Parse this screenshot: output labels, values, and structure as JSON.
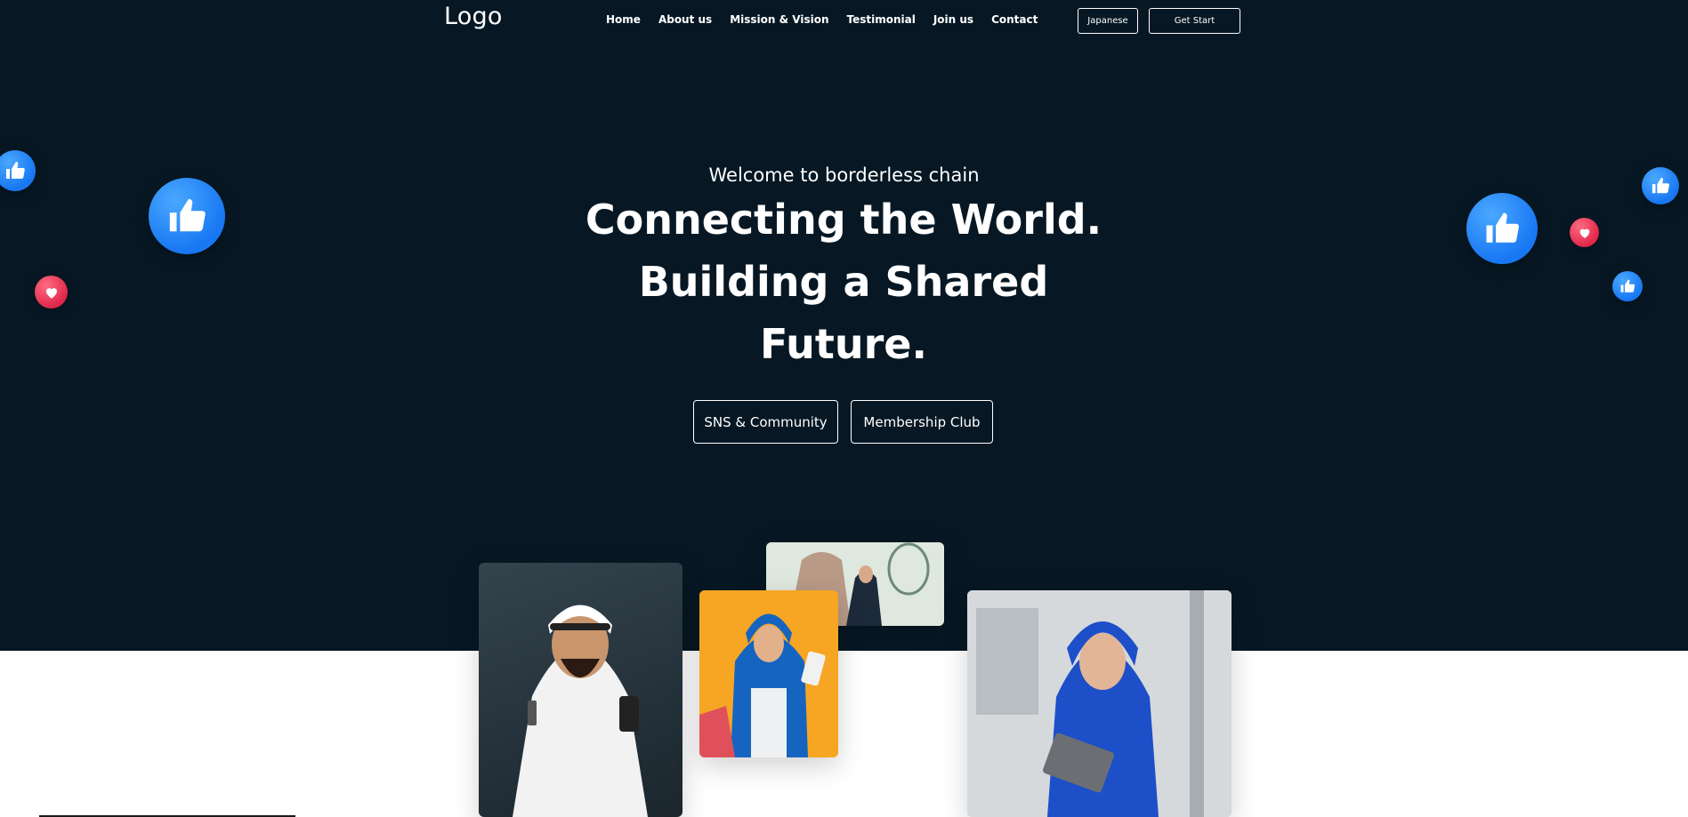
{
  "header": {
    "logo": "Logo",
    "nav": [
      "Home",
      "About us",
      "Mission & Vision",
      "Testimonial",
      "Join us",
      "Contact"
    ],
    "language_button": "Japanese",
    "get_start_button": "Get Start"
  },
  "hero": {
    "welcome": "Welcome to borderless chain",
    "headline_line1": "Connecting the World.",
    "headline_line2": "Building a Shared",
    "headline_line3": "Future.",
    "cta_sns": "SNS & Community",
    "cta_membership": "Membership Club"
  },
  "decorations": {
    "reaction_icons": [
      "like-icon",
      "heart-icon"
    ]
  },
  "colors": {
    "hero_background": "#071824",
    "like_blue": "#1877f2",
    "heart_red": "#e0284a",
    "page_background": "#ffffff"
  }
}
